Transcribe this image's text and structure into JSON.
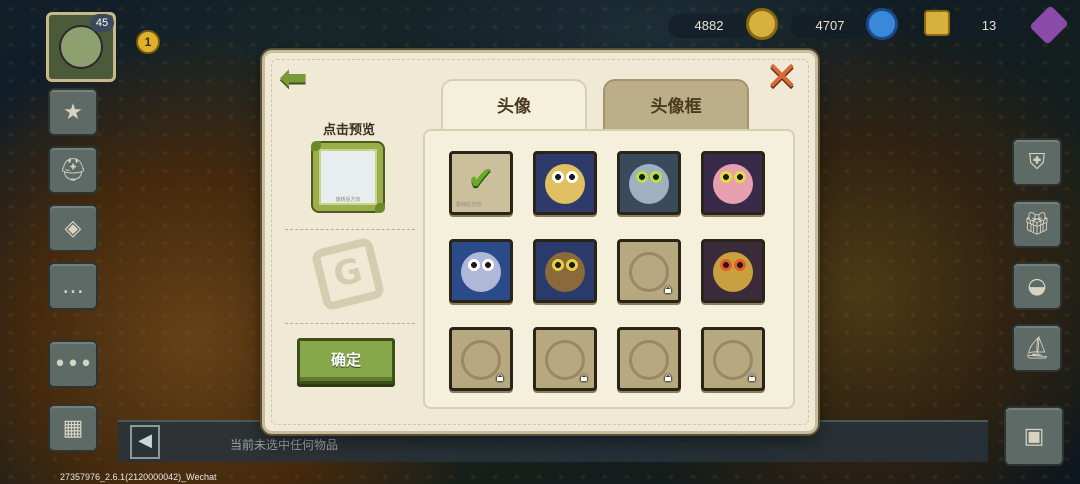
{
  "hud": {
    "player_level": "45",
    "notification_count": "1",
    "resources": [
      {
        "name": "coins",
        "value": "4882",
        "icon": "coin-icon",
        "color": "#d8b040"
      },
      {
        "name": "gems",
        "value": "4707",
        "icon": "gem-icon",
        "color": "#3a88d8"
      },
      {
        "name": "tickets",
        "value": "13",
        "icon": "ticket-icon",
        "color": "#d8b040"
      }
    ],
    "left_menu_icons": [
      "star-icon",
      "helmet-icon",
      "book-icon",
      "chat-icon",
      "more-icon",
      "map-icon"
    ],
    "right_menu_icons": [
      "shield-icon",
      "gift-icon",
      "egg-icon",
      "boat-icon",
      "chest-icon"
    ]
  },
  "bottom_bar": {
    "message": "当前未选中任何物品"
  },
  "version": "27357976_2.6.1(2120000042)_Wechat",
  "modal": {
    "back_icon": "back-arrow-icon",
    "close_icon": "close-x-icon",
    "preview_label": "点击预览",
    "preview_frame_text": "旋转后方向",
    "confirm_label": "确定",
    "tabs": [
      {
        "label": "头像",
        "active": true
      },
      {
        "label": "头像框",
        "active": false
      }
    ],
    "avatars": [
      {
        "name": "default",
        "selected": true,
        "locked": false,
        "bg": "#cbbf9c",
        "color": "#e8e0c8",
        "eye": "#ffffff",
        "note": "旋转后方向"
      },
      {
        "name": "chicken-knight",
        "selected": false,
        "locked": false,
        "bg": "#2e3a6a",
        "color": "#e0c060",
        "eye": "#ffffff"
      },
      {
        "name": "blue-mummy",
        "selected": false,
        "locked": false,
        "bg": "#3a4a5a",
        "color": "#9fb0c0",
        "eye": "#b8e040"
      },
      {
        "name": "pink-mummy",
        "selected": false,
        "locked": false,
        "bg": "#3a2a4a",
        "color": "#e8a0b0",
        "eye": "#e0e040"
      },
      {
        "name": "pirate-zombie",
        "selected": false,
        "locked": false,
        "bg": "#2a4a8a",
        "color": "#b0b8d8",
        "eye": "#ffffff"
      },
      {
        "name": "tree-sprout",
        "selected": false,
        "locked": false,
        "bg": "#2a3a6a",
        "color": "#8a6a3a",
        "eye": "#e8d040"
      },
      {
        "name": "rune-stone",
        "selected": false,
        "locked": true,
        "bg": "#b7a880",
        "color": "#a49470",
        "eye": "#a49470"
      },
      {
        "name": "owl-mask",
        "selected": false,
        "locked": false,
        "bg": "#3a2a3a",
        "color": "#c8a040",
        "eye": "#e85a2a"
      },
      {
        "name": "locked-beast-1",
        "selected": false,
        "locked": true,
        "bg": "#b7a880",
        "color": "#a49470",
        "eye": "#a49470"
      },
      {
        "name": "locked-beast-2",
        "selected": false,
        "locked": true,
        "bg": "#b7a880",
        "color": "#a49470",
        "eye": "#a49470"
      },
      {
        "name": "locked-beast-3",
        "selected": false,
        "locked": true,
        "bg": "#b7a880",
        "color": "#a49470",
        "eye": "#a49470"
      },
      {
        "name": "locked-beast-4",
        "selected": false,
        "locked": true,
        "bg": "#b7a880",
        "color": "#a49470",
        "eye": "#a49470"
      }
    ]
  }
}
